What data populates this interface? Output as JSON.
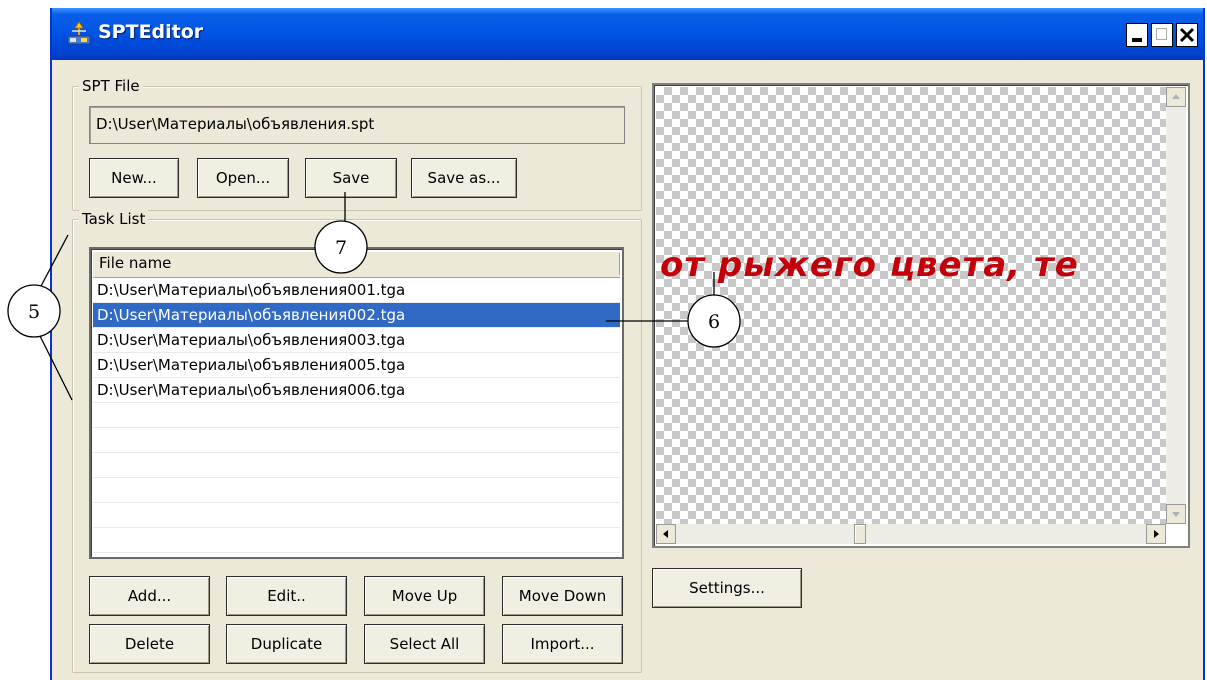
{
  "window": {
    "title": "SPTEditor",
    "controls": {
      "minimize": "_",
      "maximize": "□",
      "close": "✕"
    }
  },
  "spt_file": {
    "legend": "SPT File",
    "path": "D:\\User\\Материалы\\объявления.spt",
    "buttons": {
      "new": "New...",
      "open": "Open...",
      "save": "Save",
      "save_as": "Save as..."
    }
  },
  "task_list": {
    "legend": "Task List",
    "column_header": "File name",
    "rows": [
      "D:\\User\\Материалы\\объявления001.tga",
      "D:\\User\\Материалы\\объявления002.tga",
      "D:\\User\\Материалы\\объявления003.tga",
      "D:\\User\\Материалы\\объявления005.tga",
      "D:\\User\\Материалы\\объявления006.tga"
    ],
    "selected_row": 1,
    "buttons": {
      "add": "Add...",
      "edit": "Edit..",
      "move_up": "Move Up",
      "move_down": "Move Down",
      "delete": "Delete",
      "duplicate": "Duplicate",
      "select_all": "Select All",
      "import": "Import..."
    }
  },
  "preview": {
    "text": "от рыжего цвета, те",
    "text_color": "#c3000a"
  },
  "settings_button": "Settings...",
  "callouts": {
    "five": "5",
    "six": "6",
    "seven": "7"
  },
  "colors": {
    "titlebar": "#0055e5",
    "selection": "#316ac5",
    "window_bg": "#ece9d8"
  }
}
